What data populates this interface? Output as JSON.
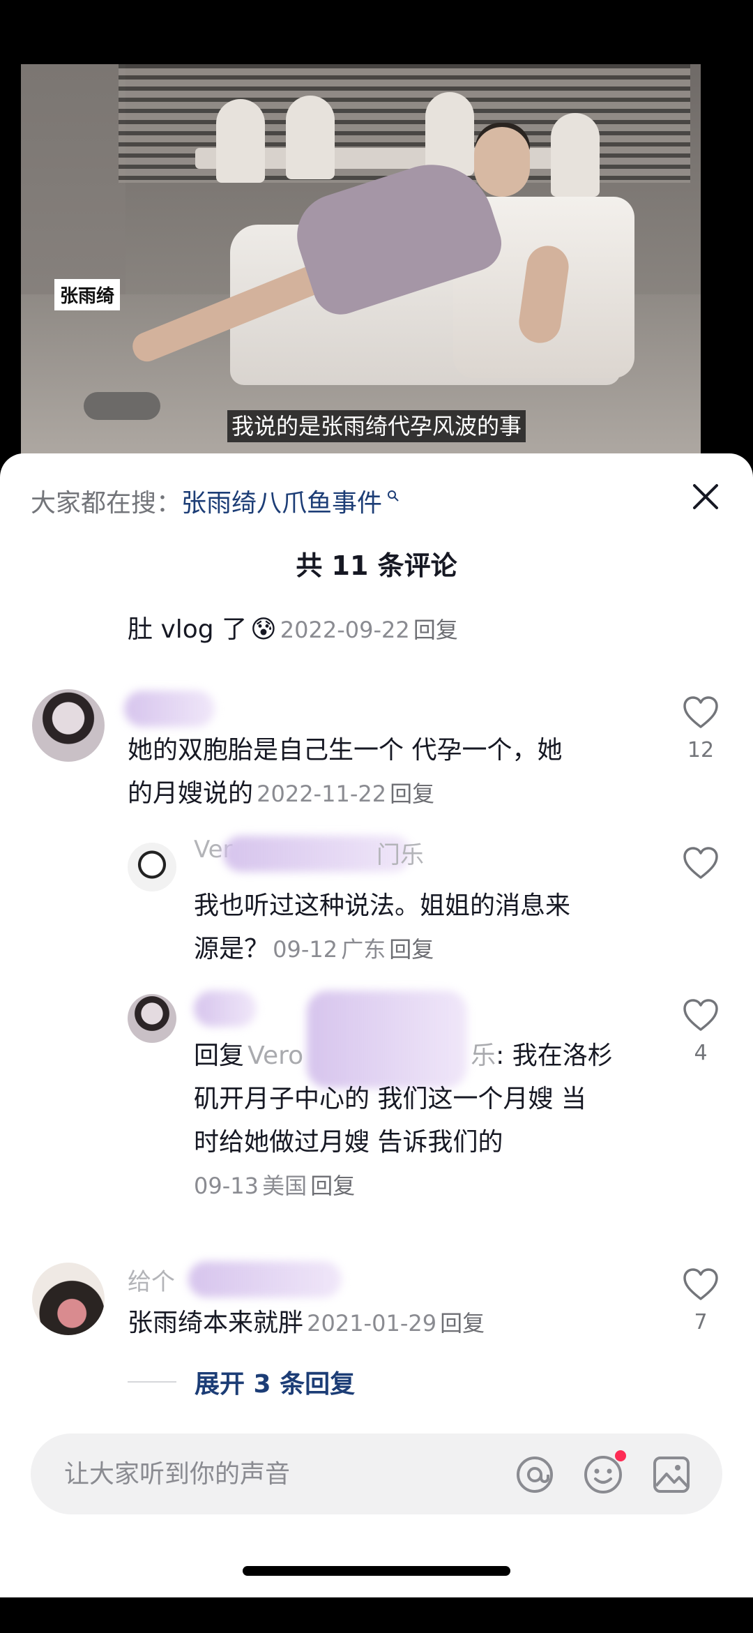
{
  "video": {
    "name_tag": "张雨绮",
    "subtitle": "我说的是张雨绮代孕风波的事"
  },
  "sheet": {
    "search_prefix": "大家都在搜：",
    "search_term": "张雨绮八爪鱼事件",
    "title": "共 11 条评论"
  },
  "comments": [
    {
      "text": "肚 vlog 了",
      "emoji": "😰",
      "date": "2022-09-22",
      "reply": "回复"
    },
    {
      "text_line1": "她的双胞胎是自己生一个 代孕一个，她",
      "text_line2": "的月嫂说的",
      "date": "2022-11-22",
      "reply": "回复",
      "likes": "12",
      "replies": [
        {
          "name": "Ver",
          "name_tail": "门乐",
          "text_line1": "我也听过这种说法。姐姐的消息来",
          "text_line2": "源是？",
          "date": "09-12",
          "location": "广东",
          "reply": "回复"
        },
        {
          "reply_prefix": "回复",
          "reply_to": "Vero",
          "reply_to_tail": "乐",
          "text_line1": ": 我在洛杉",
          "text_line2": "矶开月子中心的 我们这一个月嫂 当",
          "text_line3": "时给她做过月嫂 告诉我们的",
          "date": "09-13",
          "location": "美国",
          "reply": "回复",
          "likes": "4"
        }
      ]
    },
    {
      "name": "给个",
      "text": "张雨绮本来就胖",
      "date": "2021-01-29",
      "reply": "回复",
      "likes": "7",
      "expand": "展开 3 条回复"
    }
  ],
  "input": {
    "placeholder": "让大家听到你的声音"
  },
  "icons": {
    "close": "close-icon",
    "search": "search-icon",
    "like": "heart-outline-icon",
    "mention": "at-icon",
    "emoji": "smiley-icon",
    "image": "image-icon"
  },
  "colors": {
    "link_blue": "#1c3d76",
    "muted": "#8a8b91",
    "notify_red": "#fe2c55"
  }
}
